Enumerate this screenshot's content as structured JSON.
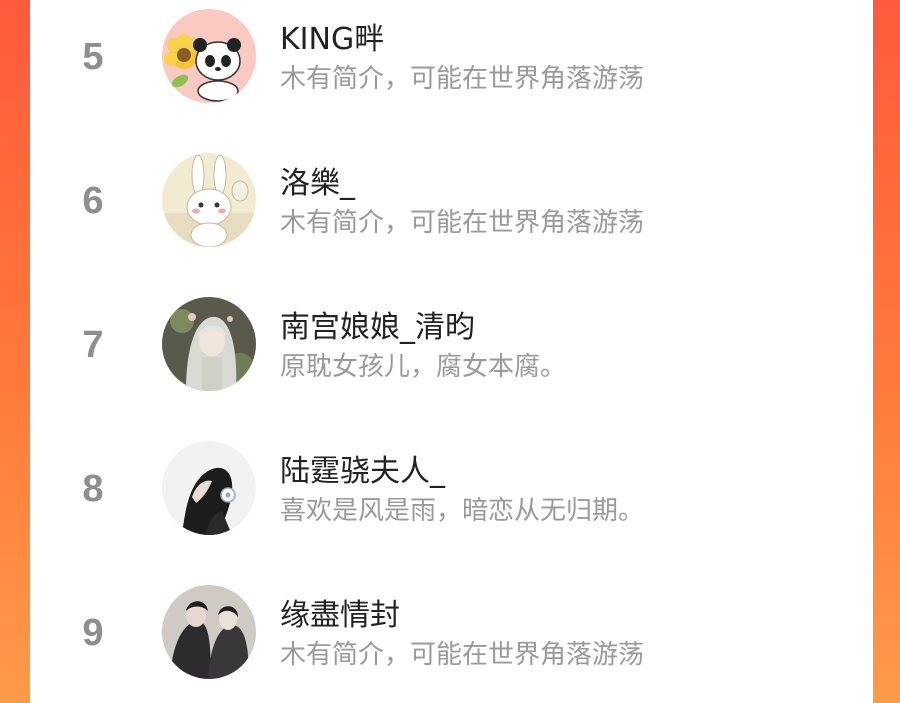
{
  "ranking": {
    "rows": [
      {
        "rank": "5",
        "name": "KING畔",
        "bio": "木有简介，可能在世界角落游荡",
        "avatar_icon": "panda-sunflower-avatar-icon"
      },
      {
        "rank": "6",
        "name": "洛樂_",
        "bio": "木有简介，可能在世界角落游荡",
        "avatar_icon": "bunny-avatar-icon"
      },
      {
        "rank": "7",
        "name": "南宫娘娘_清昀",
        "bio": "原耽女孩儿，腐女本腐。",
        "avatar_icon": "anime-girl-avatar-icon"
      },
      {
        "rank": "8",
        "name": "陆霆骁夫人_",
        "bio": "喜欢是风是雨，暗恋从无归期。",
        "avatar_icon": "woman-profile-avatar-icon"
      },
      {
        "rank": "9",
        "name": "缘盡情封",
        "bio": "木有简介，可能在世界角落游荡",
        "avatar_icon": "couple-avatar-icon"
      }
    ]
  },
  "colors": {
    "accent_left": "#ff5a3c",
    "accent_right": "#ff9a48",
    "name_text": "#222222",
    "bio_text": "#9a9a9a",
    "rank_text": "#8e8e8e"
  }
}
